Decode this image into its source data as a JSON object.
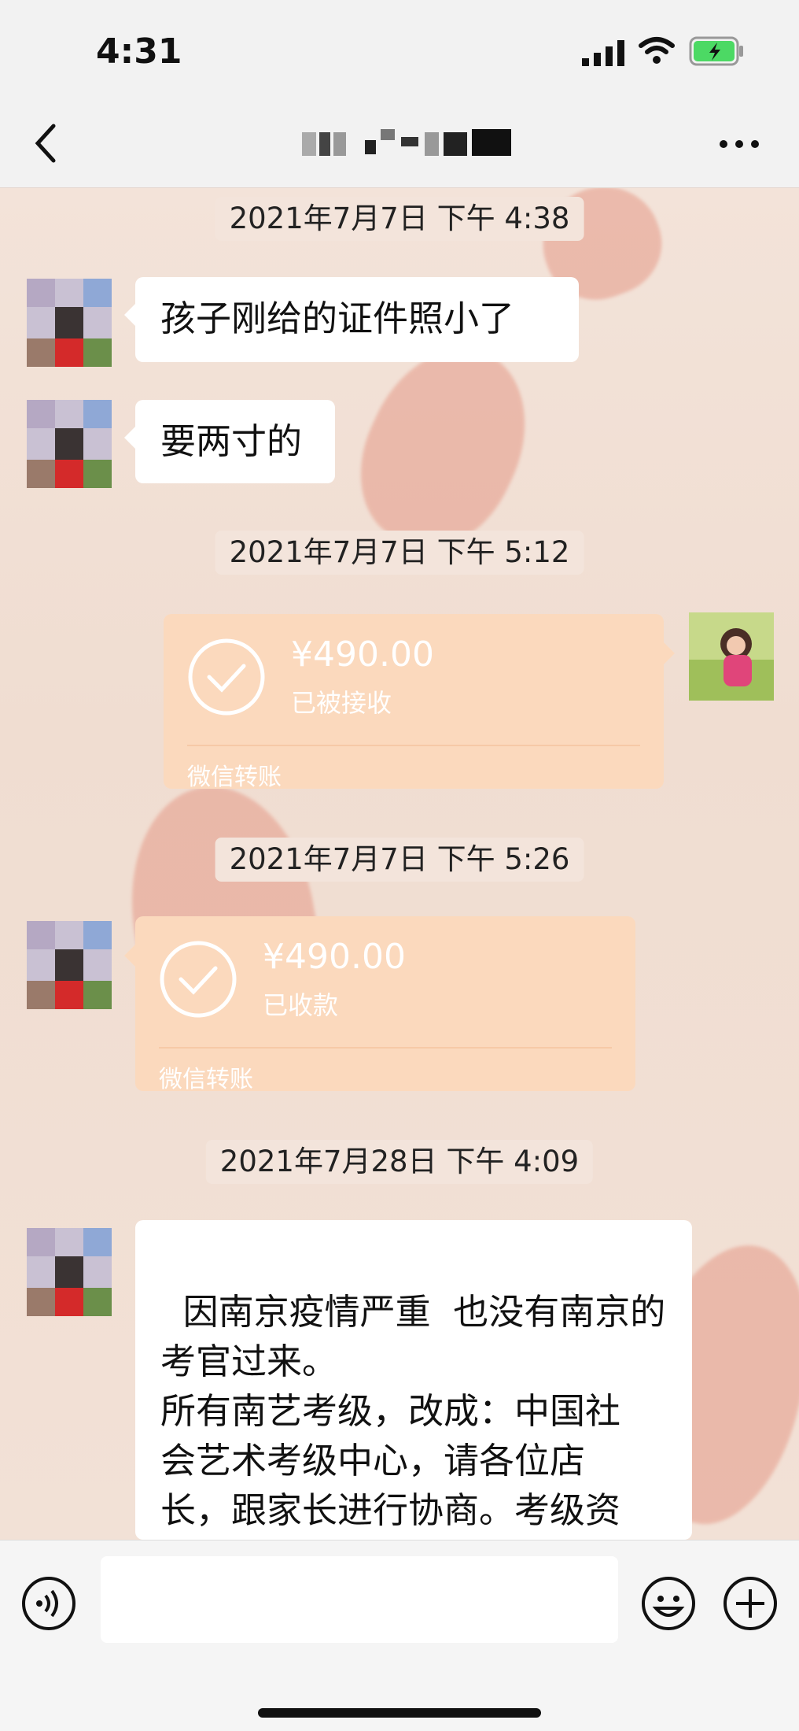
{
  "status_bar": {
    "time": "4:31",
    "battery_color": "#4cd964"
  },
  "nav": {
    "back_icon": "chevron-left-icon",
    "more_icon": "ellipsis-icon"
  },
  "messages": {
    "ts1": "2021年7月7日 下午 4:38",
    "m1": "孩子刚给的证件照小了",
    "m2": "要两寸的",
    "ts2": "2021年7月7日 下午 5:12",
    "t1": {
      "amount": "¥490.00",
      "status": "已被接收",
      "label": "微信转账"
    },
    "ts3": "2021年7月7日 下午 5:26",
    "t2": {
      "amount": "¥490.00",
      "status": "已收款",
      "label": "微信转账"
    },
    "ts4": "2021年7月28日 下午 4:09",
    "m3": "因南京疫情严重  也没有南京的\n考官过来。\n所有南艺考级，改成：中国社\n会艺术考级中心，请各位店\n长，跟家长进行协商。考级资\n质含金量，都是一样的。"
  },
  "input": {
    "placeholder": ""
  },
  "colors": {
    "transfer_bg": "#fbd9bd",
    "bubble_bg": "#ffffff",
    "chip_bg": "#f3e4db"
  }
}
